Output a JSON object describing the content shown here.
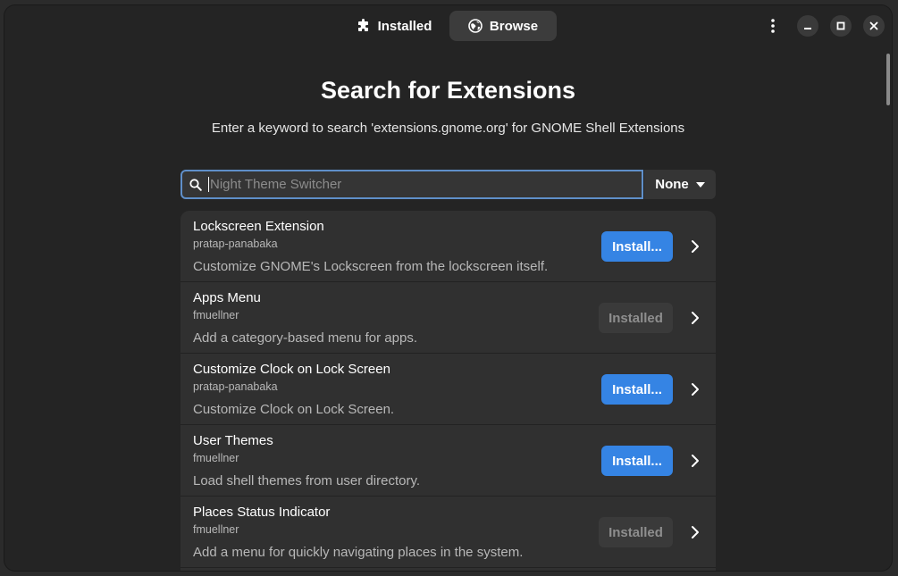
{
  "header": {
    "tabs": [
      {
        "label": "Installed",
        "icon": "puzzle-piece-icon"
      },
      {
        "label": "Browse",
        "icon": "globe-icon"
      }
    ],
    "active_tab": "Browse"
  },
  "main": {
    "title": "Search for Extensions",
    "subtitle": "Enter a keyword to search 'extensions.gnome.org' for GNOME Shell Extensions"
  },
  "search": {
    "placeholder": "Night Theme Switcher",
    "value": "",
    "sort_selected": "None"
  },
  "results": [
    {
      "name": "Lockscreen Extension",
      "author": "pratap-panabaka",
      "description": "Customize GNOME's Lockscreen from the lockscreen itself.",
      "button": "Install...",
      "state": "install"
    },
    {
      "name": "Apps Menu",
      "author": "fmuellner",
      "description": "Add a category-based menu for apps.",
      "button": "Installed",
      "state": "installed"
    },
    {
      "name": "Customize Clock on Lock Screen",
      "author": "pratap-panabaka",
      "description": "Customize Clock on Lock Screen.",
      "button": "Install...",
      "state": "install"
    },
    {
      "name": "User Themes",
      "author": "fmuellner",
      "description": "Load shell themes from user directory.",
      "button": "Install...",
      "state": "install"
    },
    {
      "name": "Places Status Indicator",
      "author": "fmuellner",
      "description": "Add a menu for quickly navigating places in the system.",
      "button": "Installed",
      "state": "installed"
    }
  ],
  "colors": {
    "accent": "#3584e4",
    "window_bg": "#242424",
    "row_bg": "#303030"
  }
}
